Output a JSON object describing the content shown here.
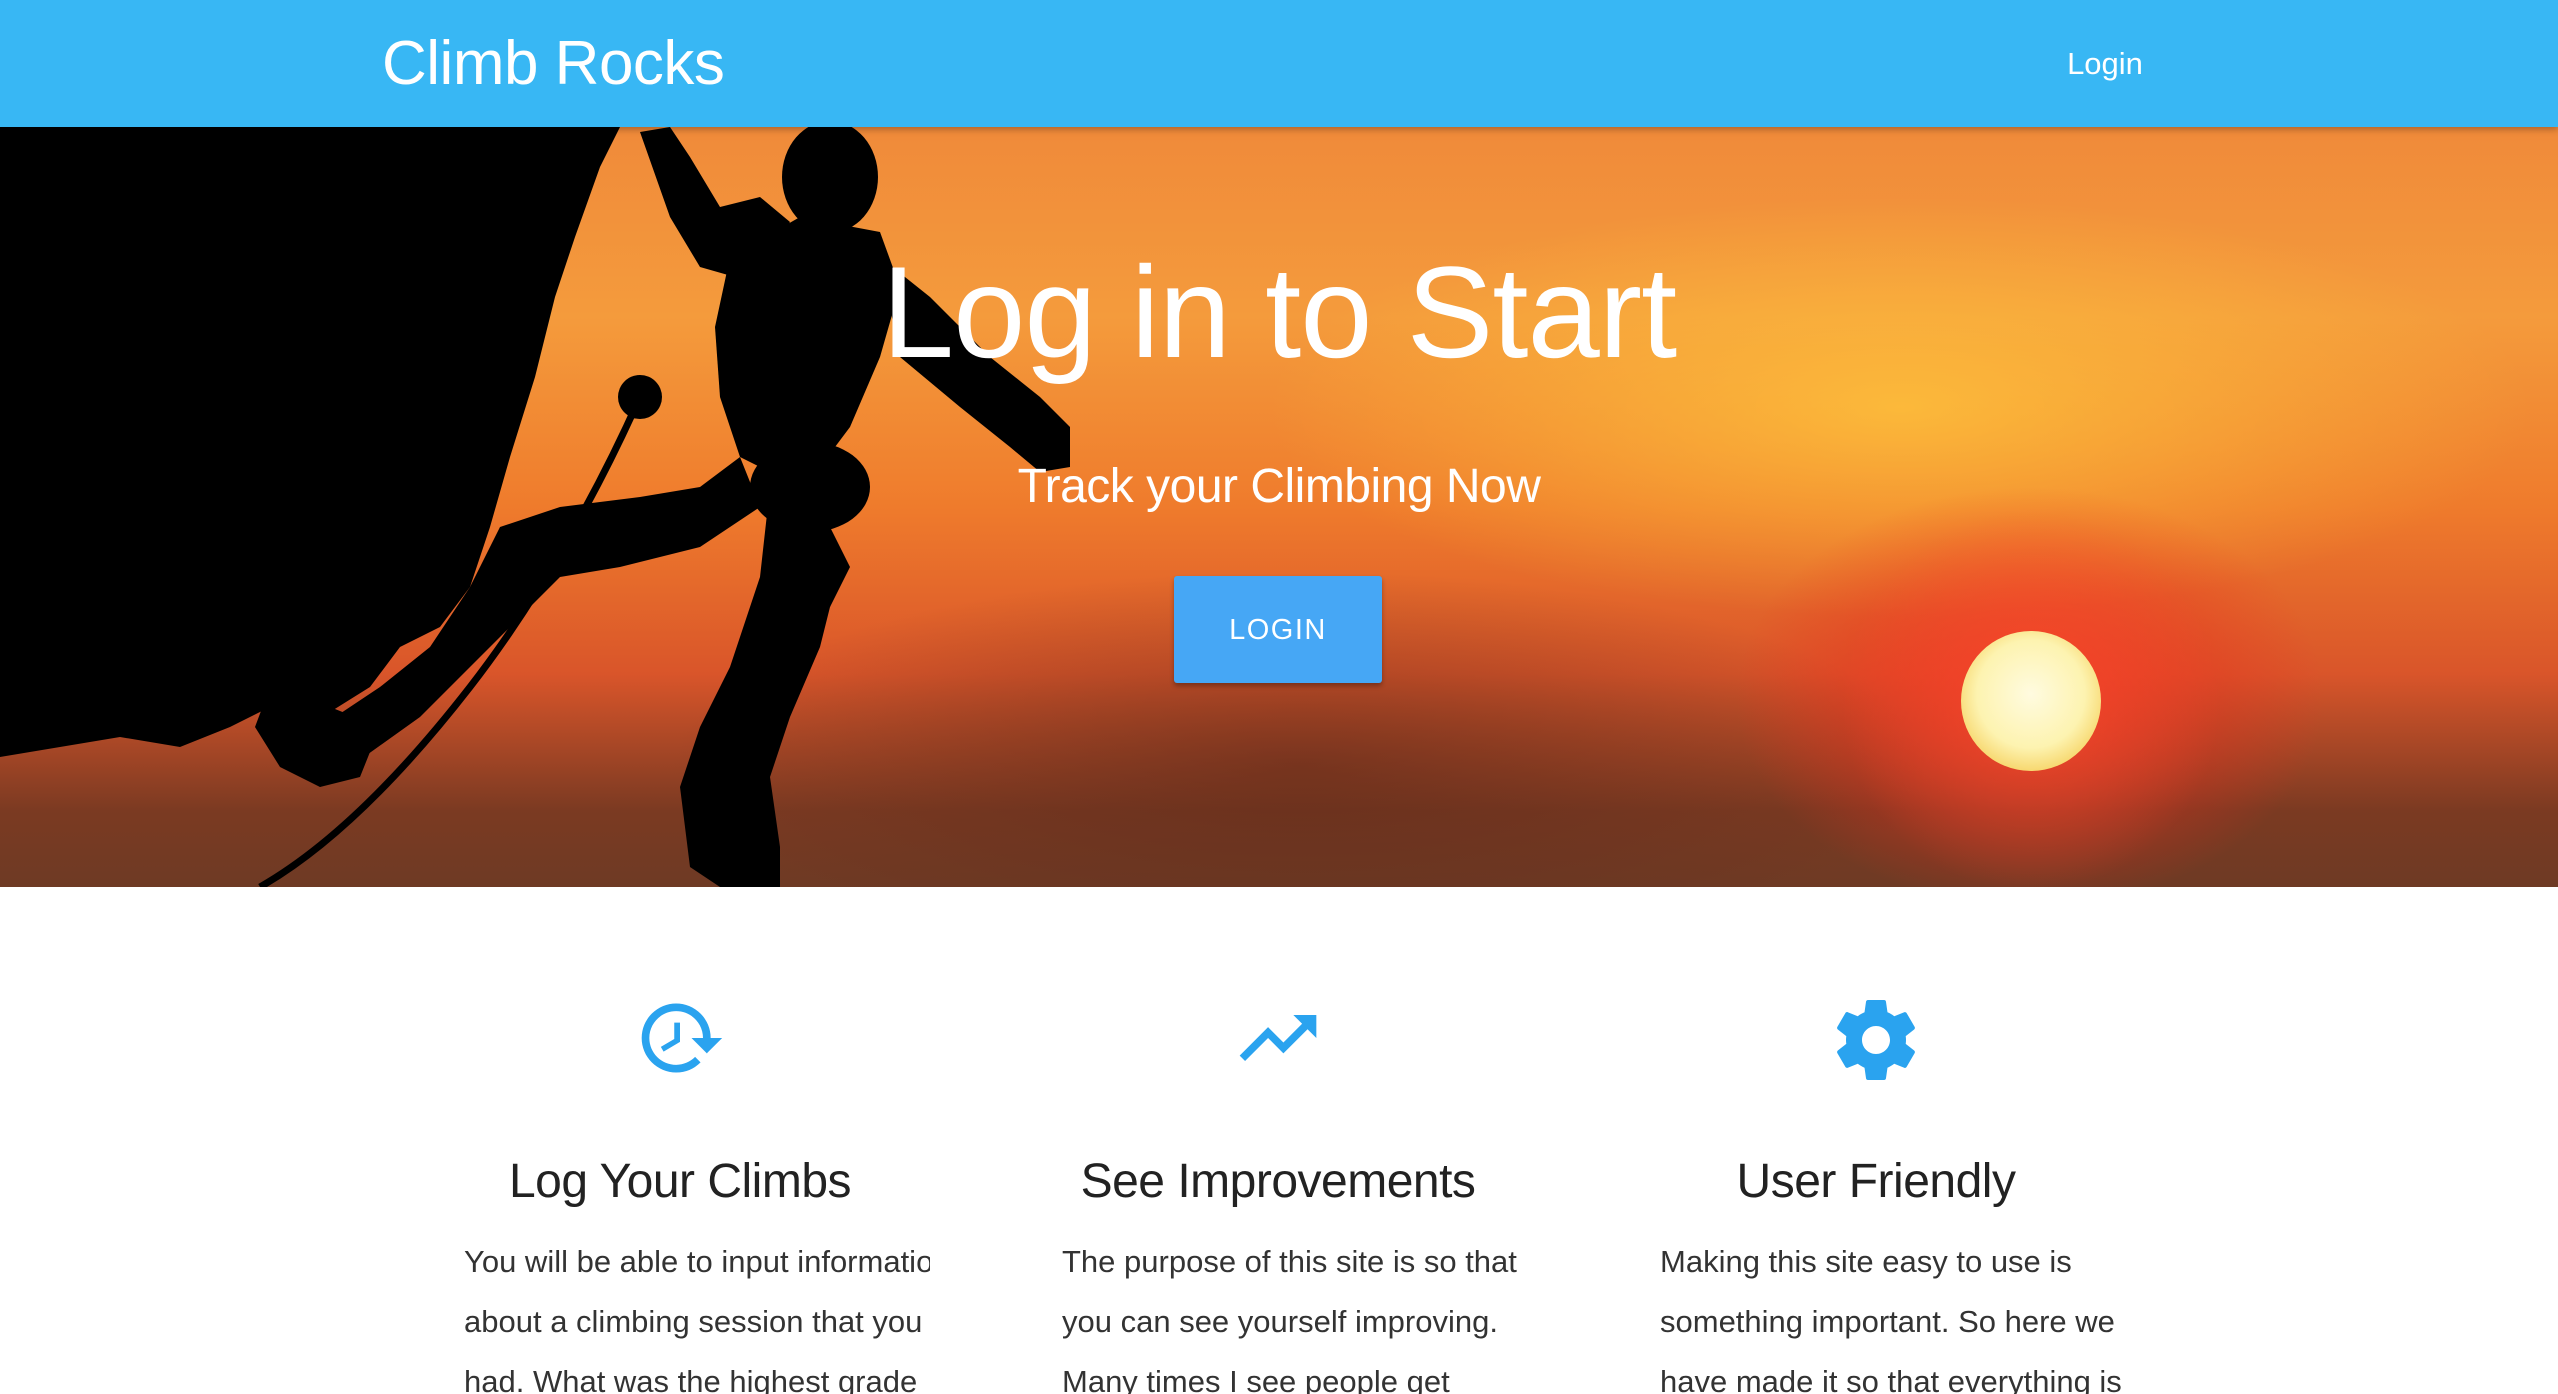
{
  "appbar": {
    "brand": "Climb Rocks",
    "login_label": "Login",
    "color": "#38b7f4"
  },
  "hero": {
    "title": "Log in to Start",
    "subtitle": "Track your Climbing Now",
    "button_label": "LOGIN",
    "button_color": "#46a7f5"
  },
  "features": [
    {
      "icon": "restore-clock-icon",
      "title": "Log Your Climbs",
      "text": "You will be able to input information about a climbing session that you had. What was the highest grade"
    },
    {
      "icon": "trending-up-icon",
      "title": "See Improvements",
      "text": "The purpose of this site is so that you can see yourself improving. Many times I see people get"
    },
    {
      "icon": "gear-icon",
      "title": "User Friendly",
      "text": "Making this site easy to use is something important. So here we have made it so that everything is"
    }
  ],
  "accent_color": "#2aa3ef"
}
